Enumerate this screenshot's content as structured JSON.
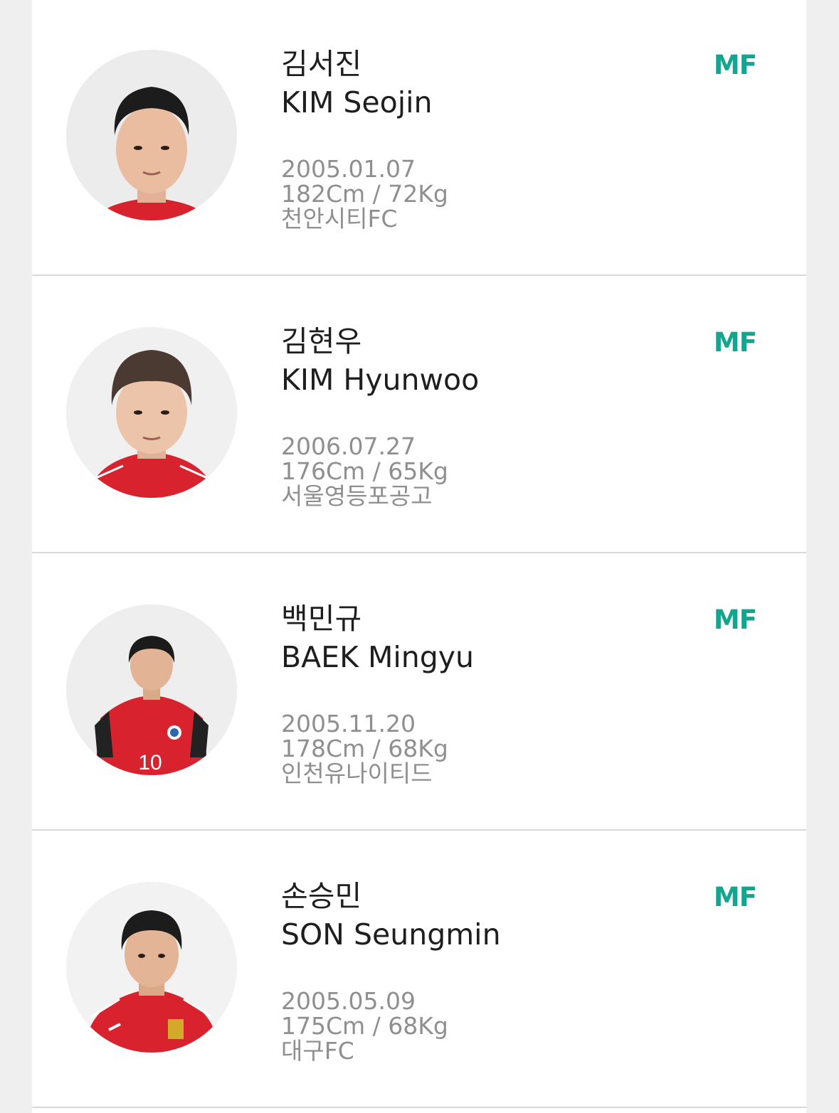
{
  "colors": {
    "accent": "#13a58e",
    "name_text": "#1e1e1e",
    "info_text": "#8f8f8f",
    "jersey_red": "#d8232e"
  },
  "players": [
    {
      "name_ko": "김서진",
      "name_en": "KIM Seojin",
      "birth": "2005.01.07",
      "body": "182Cm / 72Kg",
      "team": "천안시티FC",
      "position": "MF",
      "photo_icon": "player-photo"
    },
    {
      "name_ko": "김현우",
      "name_en": "KIM Hyunwoo",
      "birth": "2006.07.27",
      "body": "176Cm / 65Kg",
      "team": "서울영등포공고",
      "position": "MF",
      "photo_icon": "player-photo"
    },
    {
      "name_ko": "백민규",
      "name_en": "BAEK Mingyu",
      "birth": "2005.11.20",
      "body": "178Cm / 68Kg",
      "team": "인천유나이티드",
      "position": "MF",
      "photo_icon": "player-photo",
      "jersey_number": "10"
    },
    {
      "name_ko": "손승민",
      "name_en": "SON Seungmin",
      "birth": "2005.05.09",
      "body": "175Cm / 68Kg",
      "team": "대구FC",
      "position": "MF",
      "photo_icon": "player-photo"
    }
  ]
}
